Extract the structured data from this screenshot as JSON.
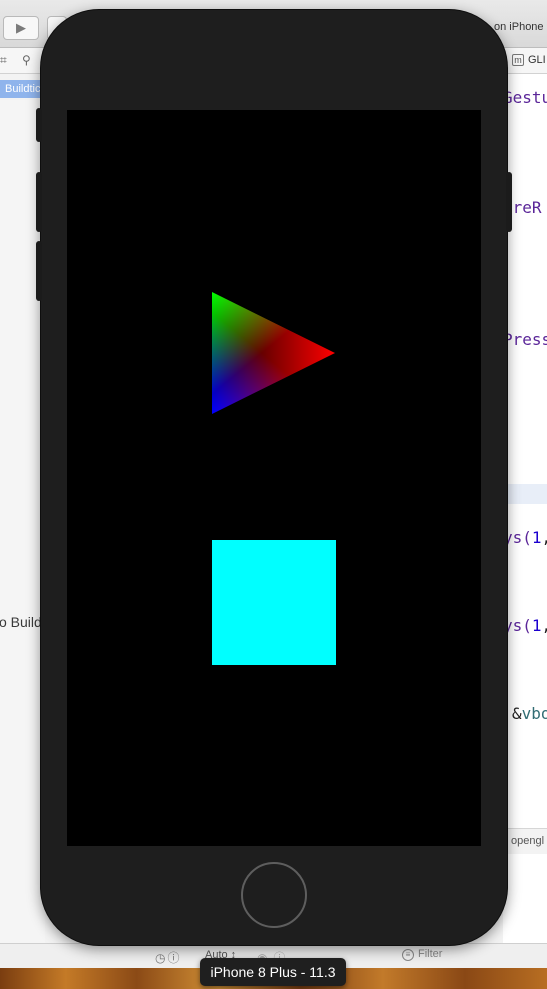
{
  "xcode": {
    "scheme_text": "on iPhone",
    "file_tab_label": "GLI",
    "build_pill_label": "Buildtic",
    "left_pane_text": "o Build",
    "code_fragments": [
      {
        "text": "Gestu"
      },
      {
        "text": "ureR"
      },
      {
        "text": "Press"
      },
      {
        "text": "ys(1,",
        "call": "ys(",
        "arg": "1",
        "tail": ","
      },
      {
        "text": "ys(1,",
        "call": "ys(",
        "arg": "1",
        "tail": ","
      },
      {
        "text": "&vbo",
        "amp": "&",
        "ident": "vbo"
      }
    ],
    "editor_footer_text": "opengl",
    "debug_bar": {
      "auto_label": "Auto ↕",
      "filter_placeholder": "Filter"
    }
  },
  "simulator": {
    "device_label": "iPhone 8 Plus - 11.3",
    "screen_background": "#000000",
    "triangle_colors": {
      "top": "#00ff00",
      "right": "#ff0000",
      "bottom": "#0000ff"
    },
    "square_color": "#00ffff"
  },
  "colors": {
    "device_body": "#1e1e1e",
    "code_keyword": "#5b2699",
    "code_number": "#1c00cf",
    "build_pill": "#8fb4ec"
  }
}
